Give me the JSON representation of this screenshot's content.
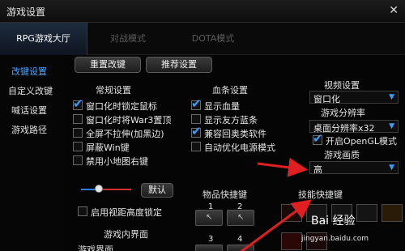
{
  "window": {
    "title": "游戏设置",
    "close_icon": "close-icon"
  },
  "tabs": [
    {
      "label": "RPG游戏大厅",
      "active": true
    },
    {
      "label": "对战模式",
      "active": false
    },
    {
      "label": "DOTA模式",
      "active": false
    }
  ],
  "sidebar": {
    "items": [
      {
        "label": "改键设置",
        "active": true
      },
      {
        "label": "自定义改键",
        "active": false
      },
      {
        "label": "喊话设置",
        "active": false
      },
      {
        "label": "游戏路径",
        "active": false
      }
    ]
  },
  "toolbar": {
    "reset_label": "重置改键",
    "recommend_label": "推荐设置"
  },
  "general": {
    "title": "常规设置",
    "options": [
      {
        "label": "窗口化时锁定鼠标",
        "checked": true
      },
      {
        "label": "窗口化时将War3置顶",
        "checked": false
      },
      {
        "label": "全屏不拉伸(加黑边)",
        "checked": false
      },
      {
        "label": "屏蔽Win键",
        "checked": false
      },
      {
        "label": "禁用小地图右键",
        "checked": false
      }
    ]
  },
  "healthbar": {
    "title": "血条设置",
    "options": [
      {
        "label": "显示血量",
        "checked": true
      },
      {
        "label": "显示友方蓝条",
        "checked": false
      },
      {
        "label": "兼容回奥类软件",
        "checked": true
      },
      {
        "label": "自动优化电源模式",
        "checked": false
      }
    ]
  },
  "video": {
    "title": "视频设置",
    "mode_value": "窗口化",
    "resolution_title": "游戏分辨率",
    "resolution_value": "桌面分辨率x32",
    "opengl_label": "开启OpenGL模式",
    "opengl_checked": true,
    "quality_title": "游戏画质",
    "quality_value": "高"
  },
  "slider": {
    "default_label": "默认",
    "level": 0.35,
    "fill_color": "#2f7de0",
    "rest_color": "#d23030"
  },
  "view_height_label": "启用视距高度锁定",
  "items_hotkeys": {
    "title": "物品快捷键",
    "keys": [
      {
        "num": "1"
      },
      {
        "num": "2"
      },
      {
        "num": "3"
      },
      {
        "num": "4"
      }
    ]
  },
  "skill_hotkeys_title": "技能快捷键",
  "game_ui": {
    "title": "游戏内界面",
    "sub_label": "游戏界面"
  },
  "annotation": {
    "arrow_color": "#e02020"
  },
  "watermark": {
    "text": "Bai 经验",
    "sub": "jingyan.baidu.com"
  }
}
